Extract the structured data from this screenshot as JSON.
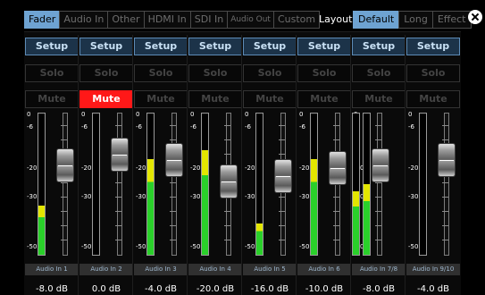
{
  "tabs": [
    {
      "label": "Fader",
      "active": true
    },
    {
      "label": "Audio In",
      "active": false
    },
    {
      "label": "Other",
      "active": false
    },
    {
      "label": "HDMI In",
      "active": false
    },
    {
      "label": "SDI In",
      "active": false
    },
    {
      "label": "Audio Out",
      "active": false,
      "small": true
    },
    {
      "label": "Custom",
      "active": false
    }
  ],
  "layout": {
    "label": "Layout",
    "options": [
      {
        "label": "Default",
        "active": true
      },
      {
        "label": "Long",
        "active": false
      },
      {
        "label": "Effect",
        "active": false
      }
    ]
  },
  "close_icon": "close-icon",
  "scale": [
    "0",
    "-6",
    "-20",
    "-30",
    "-50"
  ],
  "channels": [
    {
      "setup": "Setup",
      "solo": "Solo",
      "mute": "Mute",
      "muted": false,
      "meter_level": 0.35,
      "meter_side": "left",
      "fader_db": -8.0,
      "name": "Audio In 1",
      "db_label": "-8.0 dB"
    },
    {
      "setup": "Setup",
      "solo": "Solo",
      "mute": "Mute",
      "muted": true,
      "meter_level": 0.0,
      "meter_side": "right",
      "fader_db": 0.0,
      "name": "Audio In 2",
      "db_label": "0.0 dB"
    },
    {
      "setup": "Setup",
      "solo": "Solo",
      "mute": "Mute",
      "muted": false,
      "meter_level": 0.68,
      "meter_side": "left",
      "fader_db": -4.0,
      "name": "Audio In 3",
      "db_label": "-4.0 dB"
    },
    {
      "setup": "Setup",
      "solo": "Solo",
      "mute": "Mute",
      "muted": false,
      "meter_level": 0.74,
      "meter_side": "left",
      "fader_db": -20.0,
      "name": "Audio In 4",
      "db_label": "-20.0 dB"
    },
    {
      "setup": "Setup",
      "solo": "Solo",
      "mute": "Mute",
      "muted": false,
      "meter_level": 0.22,
      "meter_side": "left",
      "fader_db": -16.0,
      "name": "Audio In 5",
      "db_label": "-16.0 dB"
    },
    {
      "setup": "Setup",
      "solo": "Solo",
      "mute": "Mute",
      "muted": false,
      "meter_level": 0.68,
      "meter_side": "left",
      "fader_db": -10.0,
      "name": "Audio In 6",
      "db_label": "-10.0 dB"
    },
    {
      "setup": "Setup",
      "solo": "Solo",
      "mute": "Mute",
      "muted": false,
      "meter_level": 0.45,
      "meter_side": "dual",
      "fader_db": -8.0,
      "name": "Audio In 7/8",
      "db_label": "-8.0 dB"
    },
    {
      "setup": "Setup",
      "solo": "Solo",
      "mute": "Mute",
      "muted": false,
      "meter_level": 0.0,
      "meter_side": "right",
      "fader_db": -4.0,
      "name": "Audio In 9/10",
      "db_label": "-4.0 dB"
    }
  ]
}
